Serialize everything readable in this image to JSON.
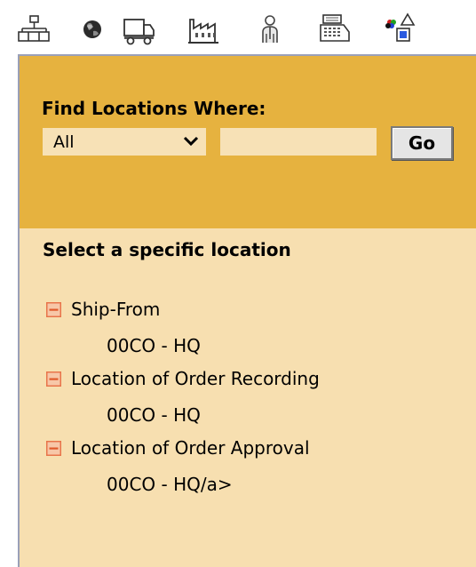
{
  "toolbar": {
    "icons": [
      {
        "name": "organization-icon"
      },
      {
        "name": "globe-icon"
      },
      {
        "name": "truck-icon"
      },
      {
        "name": "factory-icon"
      },
      {
        "name": "person-icon"
      },
      {
        "name": "register-icon"
      },
      {
        "name": "shapes-icon"
      }
    ]
  },
  "find": {
    "title": "Find Locations Where:",
    "select_value": "All",
    "input_value": "",
    "go_label": "Go"
  },
  "locations": {
    "title": "Select a specific location",
    "groups": [
      {
        "label": "Ship-From",
        "child": "00CO - HQ"
      },
      {
        "label": "Location of Order Recording",
        "child": "00CO - HQ"
      },
      {
        "label": "Location of Order Approval",
        "child": "00CO - HQ/a>"
      }
    ]
  },
  "colors": {
    "find_background": "#e6b23f",
    "panel_background": "#f7dfb0",
    "collapse_icon": "#e8744a"
  }
}
